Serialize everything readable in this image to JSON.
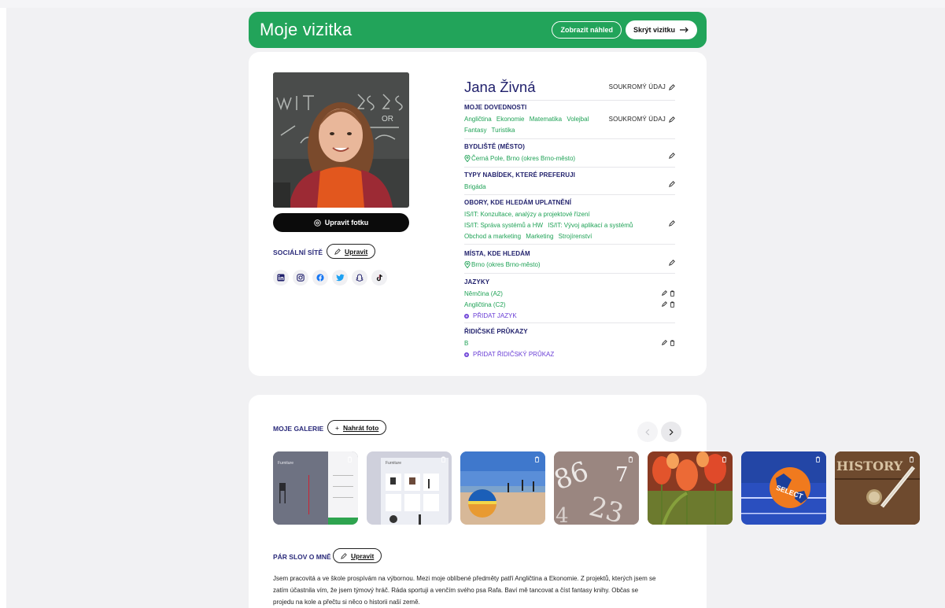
{
  "header": {
    "title": "Moje vizitka",
    "preview_label": "Zobrazit náhled",
    "hide_label": "Skrýt vizitku"
  },
  "photo": {
    "edit_label": "Upravit fotku"
  },
  "social": {
    "label": "SOCIÁLNÍ SÍTĚ",
    "edit_label": "Upravit",
    "icons": [
      "linkedin-icon",
      "instagram-icon",
      "facebook-icon",
      "twitter-icon",
      "snapchat-icon",
      "tiktok-icon"
    ]
  },
  "profile": {
    "name": "Jana Živná",
    "privacy_label": "SOUKROMÝ ÚDAJ",
    "skills": {
      "title": "MOJE DOVEDNOSTI",
      "items": [
        "Angličtina",
        "Ekonomie",
        "Matematika",
        "Volejbal",
        "Fantasy",
        "Turistika"
      ],
      "privacy_label": "SOUKROMÝ ÚDAJ"
    },
    "residence": {
      "title": "BYDLIŠTĚ (MĚSTO)",
      "value": "Černá Pole, Brno (okres Brno-město)"
    },
    "offers": {
      "title": "TYPY NABÍDEK, KTERÉ PREFERUJI",
      "value": "Brigáda"
    },
    "fields": {
      "title": "OBORY, KDE HLEDÁM UPLATNĚNÍ",
      "line1": "IS/IT: Konzultace, analýzy a projektové řízení",
      "line2a": "IS/IT: Správa systémů a HW",
      "line2b": "IS/IT: Vývoj aplikací a systémů",
      "line3a": "Obchod a marketing",
      "line3b": "Marketing",
      "line3c": "Strojírenství"
    },
    "places": {
      "title": "MÍSTA, KDE HLEDÁM",
      "value": "Brno (okres Brno-město)"
    },
    "languages": {
      "title": "JAZYKY",
      "items": [
        "Němčina (A2)",
        "Angličtina (C2)"
      ],
      "add_label": "PŘIDAT JAZYK"
    },
    "licenses": {
      "title": "ŘIDIČSKÉ PRŮKAZY",
      "items": [
        "B"
      ],
      "add_label": "PŘIDAT ŘIDIČSKÝ PRŮKAZ"
    }
  },
  "gallery": {
    "label": "MOJE GALERIE",
    "upload_label": "Nahrát foto",
    "thumbnail_texts": [
      "Furniture",
      "Furniture",
      "",
      "",
      "",
      "SELECT",
      "HISTORY"
    ]
  },
  "about": {
    "label": "PÁR SLOV O MNĚ",
    "edit_label": "Upravit",
    "line1": "Jsem pracovitá a ve škole prospívám na výbornou. Mezi moje oblíbené předměty patří Angličtina a Ekonomie. Z projektů, kterých jsem se",
    "line2": "zatím účastnila vím, že jsem týmový hráč. Ráda sportuji a venčím svého psa Rafa. Baví mě tancovat a číst fantasy knihy. Občas se",
    "line3": "projedu na kole a přečtu si něco o historii naší země."
  },
  "colors": {
    "brand_green": "#22a45a",
    "navy": "#1f1f6b",
    "purple": "#6a3fd6",
    "text_green": "#1fa256"
  }
}
